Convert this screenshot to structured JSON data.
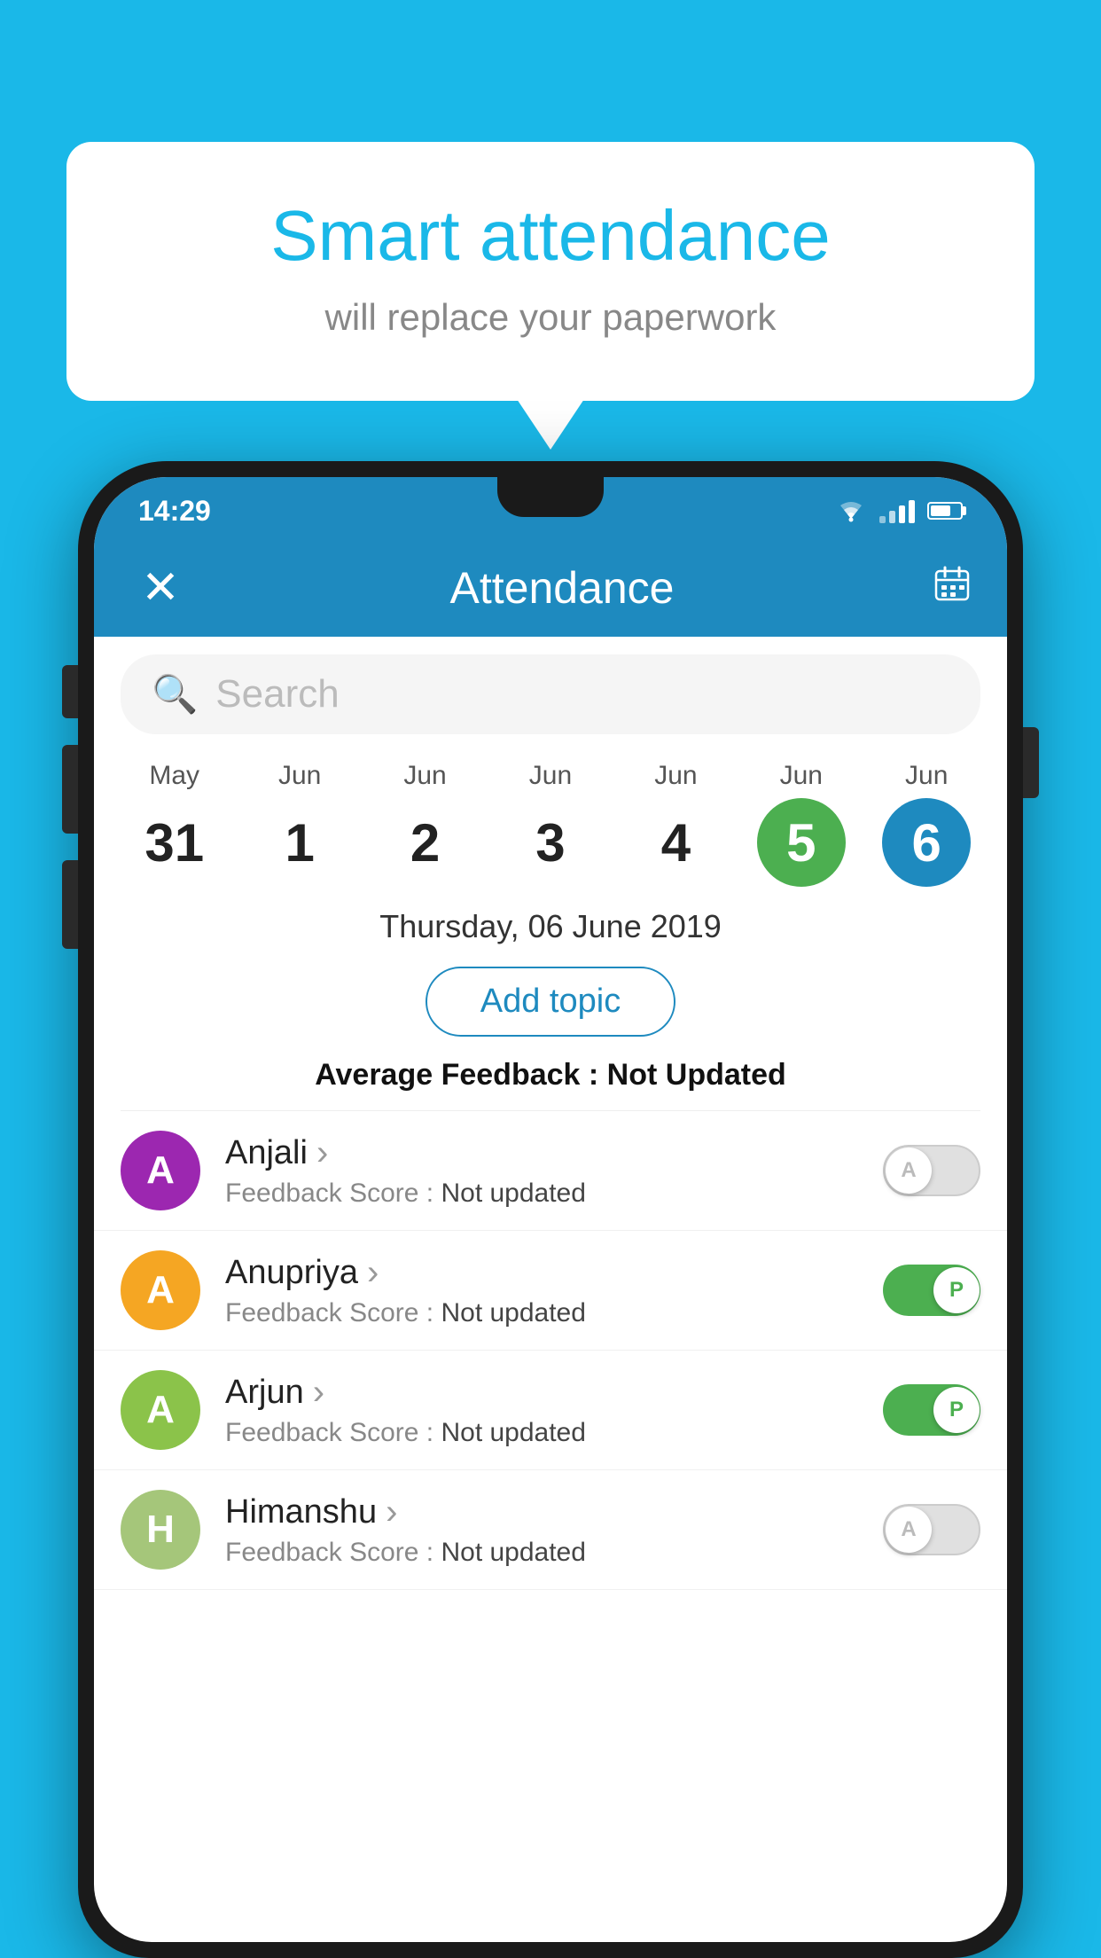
{
  "background_color": "#1ab8e8",
  "bubble": {
    "title": "Smart attendance",
    "subtitle": "will replace your paperwork"
  },
  "status_bar": {
    "time": "14:29"
  },
  "header": {
    "title": "Attendance",
    "close_label": "✕",
    "calendar_icon": "calendar-icon"
  },
  "search": {
    "placeholder": "Search"
  },
  "calendar": {
    "days": [
      {
        "month": "May",
        "date": "31",
        "style": "normal"
      },
      {
        "month": "Jun",
        "date": "1",
        "style": "normal"
      },
      {
        "month": "Jun",
        "date": "2",
        "style": "normal"
      },
      {
        "month": "Jun",
        "date": "3",
        "style": "normal"
      },
      {
        "month": "Jun",
        "date": "4",
        "style": "normal"
      },
      {
        "month": "Jun",
        "date": "5",
        "style": "today"
      },
      {
        "month": "Jun",
        "date": "6",
        "style": "selected"
      }
    ]
  },
  "selected_date": "Thursday, 06 June 2019",
  "add_topic_label": "Add topic",
  "avg_feedback_label": "Average Feedback :",
  "avg_feedback_value": "Not Updated",
  "students": [
    {
      "name": "Anjali",
      "avatar_letter": "A",
      "avatar_color": "#9c27b0",
      "feedback_label": "Feedback Score :",
      "feedback_value": "Not updated",
      "toggle": "off",
      "toggle_letter": "A"
    },
    {
      "name": "Anupriya",
      "avatar_letter": "A",
      "avatar_color": "#f5a623",
      "feedback_label": "Feedback Score :",
      "feedback_value": "Not updated",
      "toggle": "on",
      "toggle_letter": "P"
    },
    {
      "name": "Arjun",
      "avatar_letter": "A",
      "avatar_color": "#8bc34a",
      "feedback_label": "Feedback Score :",
      "feedback_value": "Not updated",
      "toggle": "on",
      "toggle_letter": "P"
    },
    {
      "name": "Himanshu",
      "avatar_letter": "H",
      "avatar_color": "#a5c67a",
      "feedback_label": "Feedback Score :",
      "feedback_value": "Not updated",
      "toggle": "off",
      "toggle_letter": "A"
    }
  ]
}
